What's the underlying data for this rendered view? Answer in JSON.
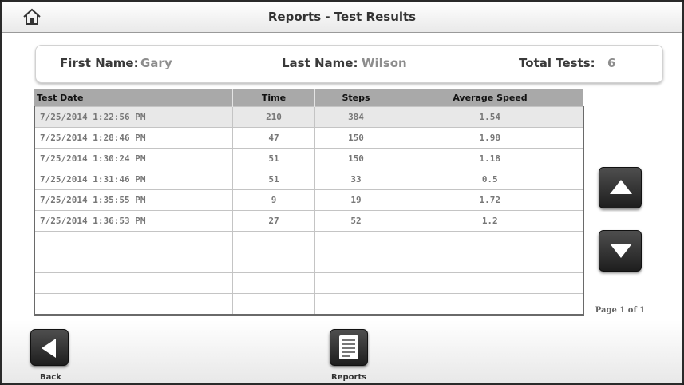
{
  "header": {
    "title": "Reports - Test Results",
    "home_icon": "home-icon"
  },
  "info": {
    "first_name_label": "First Name:",
    "first_name_value": "Gary",
    "last_name_label": "Last Name:",
    "last_name_value": "Wilson",
    "total_tests_label": "Total Tests:",
    "total_tests_value": "6"
  },
  "table": {
    "columns": [
      "Test Date",
      "Time",
      "Steps",
      "Average Speed"
    ],
    "rows": [
      [
        "7/25/2014 1:22:56 PM",
        "210",
        "384",
        "1.54"
      ],
      [
        "7/25/2014 1:28:46 PM",
        "47",
        "150",
        "1.98"
      ],
      [
        "7/25/2014 1:30:24 PM",
        "51",
        "150",
        "1.18"
      ],
      [
        "7/25/2014 1:31:46 PM",
        "51",
        "33",
        "0.5"
      ],
      [
        "7/25/2014 1:35:55 PM",
        "9",
        "19",
        "1.72"
      ],
      [
        "7/25/2014 1:36:53 PM",
        "27",
        "52",
        "1.2"
      ]
    ],
    "selected_row": 0,
    "empty_rows": 4
  },
  "scroll": {
    "up_icon": "arrow-up-icon",
    "down_icon": "arrow-down-icon",
    "page_info": "Page 1 of 1"
  },
  "footer": {
    "back_label": "Back",
    "reports_label": "Reports",
    "back_icon": "arrow-left-icon",
    "reports_icon": "report-document-icon"
  }
}
